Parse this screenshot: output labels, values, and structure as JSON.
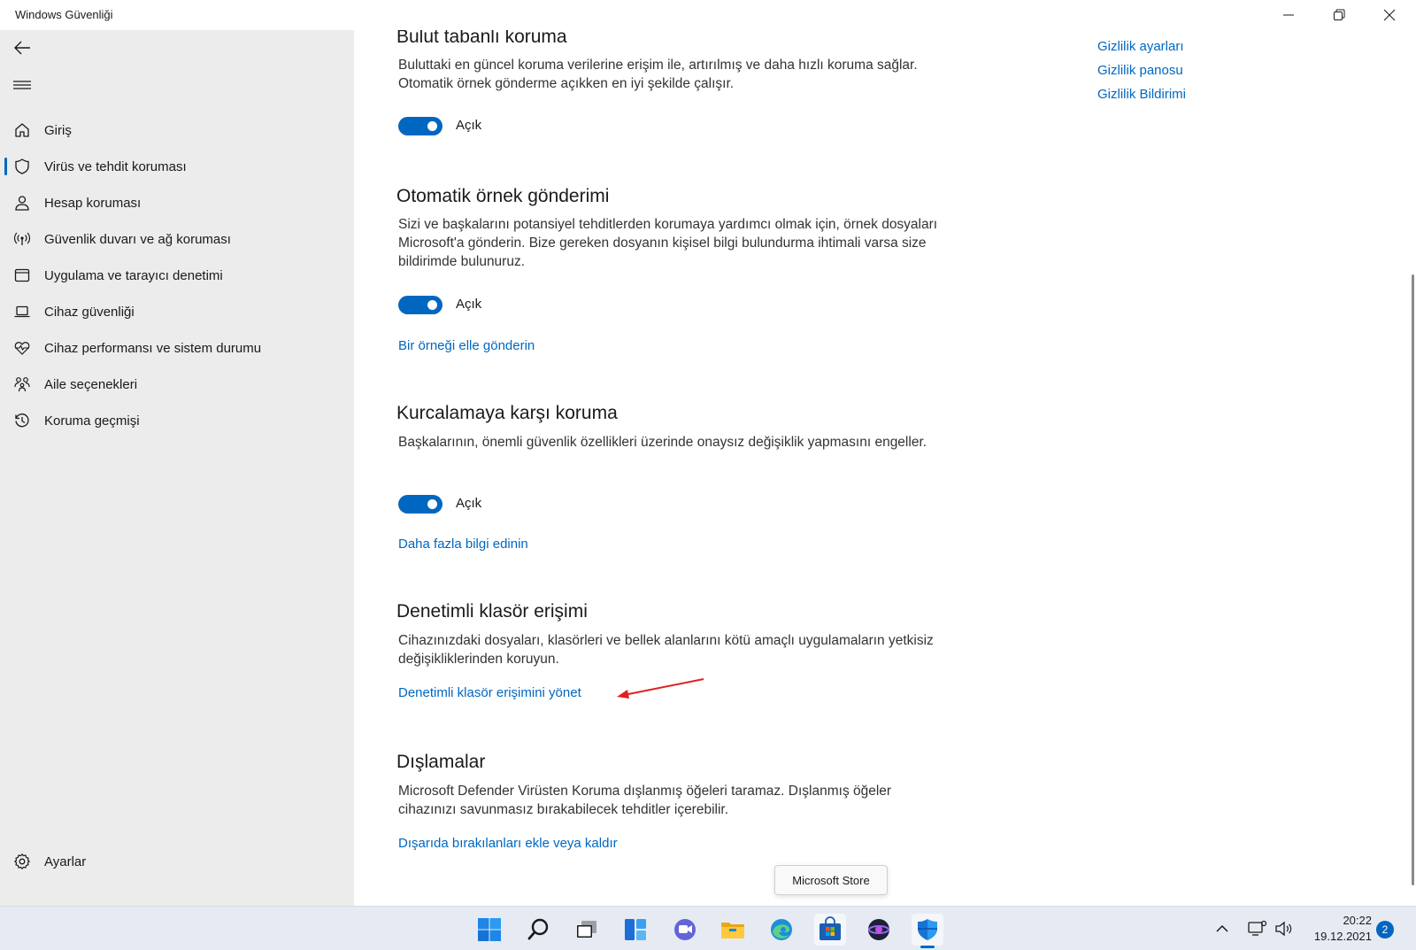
{
  "window": {
    "title": "Windows Güvenliği"
  },
  "sidebar": {
    "items": [
      {
        "label": "Giriş",
        "icon": "home-icon"
      },
      {
        "label": "Virüs ve tehdit koruması",
        "icon": "shield-icon",
        "active": true
      },
      {
        "label": "Hesap koruması",
        "icon": "person-icon"
      },
      {
        "label": "Güvenlik duvarı ve ağ koruması",
        "icon": "antenna-icon"
      },
      {
        "label": "Uygulama ve tarayıcı denetimi",
        "icon": "browser-window-icon"
      },
      {
        "label": "Cihaz güvenliği",
        "icon": "laptop-icon"
      },
      {
        "label": "Cihaz performansı ve sistem durumu",
        "icon": "heart-pulse-icon"
      },
      {
        "label": "Aile seçenekleri",
        "icon": "family-icon"
      },
      {
        "label": "Koruma geçmişi",
        "icon": "history-icon"
      }
    ],
    "settings_label": "Ayarlar"
  },
  "right_links": {
    "privacy_settings": "Gizlilik ayarları",
    "privacy_dashboard": "Gizlilik panosu",
    "privacy_statement": "Gizlilik Bildirimi"
  },
  "sections": {
    "cloud": {
      "title": "Bulut tabanlı koruma",
      "desc": "Buluttaki en güncel koruma verilerine erişim ile, artırılmış ve daha hızlı koruma sağlar. Otomatik örnek gönderme açıkken en iyi şekilde çalışır.",
      "toggle_label": "Açık"
    },
    "sample": {
      "title": "Otomatik örnek gönderimi",
      "desc": "Sizi ve başkalarını potansiyel tehditlerden korumaya yardımcı olmak için, örnek dosyaları Microsoft'a gönderin. Bize gereken dosyanın kişisel bilgi bulundurma ihtimali varsa size bildirimde bulunuruz.",
      "toggle_label": "Açık",
      "link": "Bir örneği elle gönderin"
    },
    "tamper": {
      "title": "Kurcalamaya karşı koruma",
      "desc": "Başkalarının, önemli güvenlik özellikleri üzerinde onaysız değişiklik yapmasını engeller.",
      "toggle_label": "Açık",
      "link": "Daha fazla bilgi edinin"
    },
    "folder": {
      "title": "Denetimli klasör erişimi",
      "desc": "Cihazınızdaki dosyaları, klasörleri ve bellek alanlarını kötü amaçlı uygulamaların yetkisiz değişikliklerinden koruyun.",
      "link": "Denetimli klasör erişimini yönet"
    },
    "exclusions": {
      "title": "Dışlamalar",
      "desc": "Microsoft Defender Virüsten Koruma dışlanmış öğeleri taramaz. Dışlanmış öğeler cihazınızı savunmasız bırakabilecek tehditler içerebilir.",
      "link": "Dışarıda bırakılanları ekle veya kaldır"
    }
  },
  "tooltip": "Microsoft Store",
  "taskbar": {
    "icons": [
      "windows-start-icon",
      "search-icon",
      "task-view-icon",
      "widgets-icon",
      "chat-icon",
      "file-explorer-icon",
      "edge-icon",
      "microsoft-store-icon",
      "app-icon",
      "windows-security-icon"
    ],
    "time": "20:22",
    "date": "19.12.2021",
    "notification_count": "2"
  },
  "colors": {
    "accent": "#0067c0",
    "sidebar_bg": "#ececec",
    "annotation_arrow": "#e02020"
  }
}
